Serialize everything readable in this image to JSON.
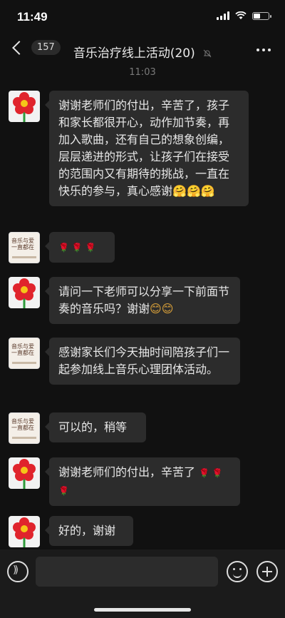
{
  "status_bar": {
    "time": "11:49"
  },
  "header": {
    "back_count": "157",
    "title": "音乐治疗线上活动(20)"
  },
  "timestamp": "11:03",
  "messages": [
    {
      "avatar": "flower-avatar",
      "text": "谢谢老师们的付出，辛苦了，孩子和家长都很开心，动作加节奏，再加入歌曲，还有自己的想象创编，层层递进的形式，让孩子们在接受的范围内又有期待的挑战，一直在快乐的参与，真心感谢",
      "emoji": "🤗🤗🤗"
    },
    {
      "avatar": "logo-avatar",
      "text": "",
      "emoji": "🌹 🌹 🌹"
    },
    {
      "avatar": "flower-avatar",
      "text": "请问一下老师可以分享一下前面节奏的音乐吗？谢谢",
      "emoji": "😊😊"
    },
    {
      "avatar": "logo-avatar",
      "text": "感谢家长们今天抽时间陪孩子们一起参加线上音乐心理团体活动。",
      "emoji": ""
    },
    {
      "avatar": "logo-avatar",
      "text": "可以的，稍等",
      "emoji": ""
    },
    {
      "avatar": "flower-avatar",
      "text": "谢谢老师们的付出，辛苦了",
      "emoji": "🌹 🌹 🌹"
    },
    {
      "avatar": "flower-avatar",
      "text": "好的，谢谢",
      "emoji": ""
    }
  ],
  "logo_text": "音乐与爱 一直都在",
  "colors": {
    "background": "#111111",
    "bubble": "#2c2c2c",
    "text": "#e8e8e8"
  }
}
